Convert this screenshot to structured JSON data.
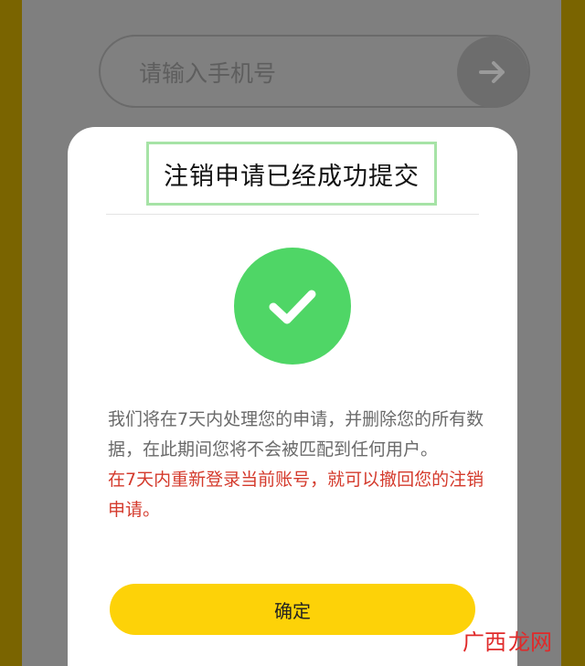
{
  "login": {
    "phone_placeholder": "请输入手机号",
    "submit_icon": "arrow-right-icon"
  },
  "dialog": {
    "title": "注销申请已经成功提交",
    "status_icon": "checkmark-icon",
    "message_normal": "我们将在7天内处理您的申请，并删除您的所有数据，在此期间您将不会被匹配到任何用户。",
    "message_highlight": "在7天内重新登录当前账号，就可以撤回您的注销申请。",
    "confirm_label": "确定"
  },
  "watermark": {
    "text_1": "广西",
    "text_2": "龙网"
  },
  "colors": {
    "accent_yellow": "#fdd208",
    "success_green": "#4fd666",
    "warning_red": "#d43a2c",
    "title_frame": "#a6e3a6",
    "side_bar": "#7a6400"
  }
}
